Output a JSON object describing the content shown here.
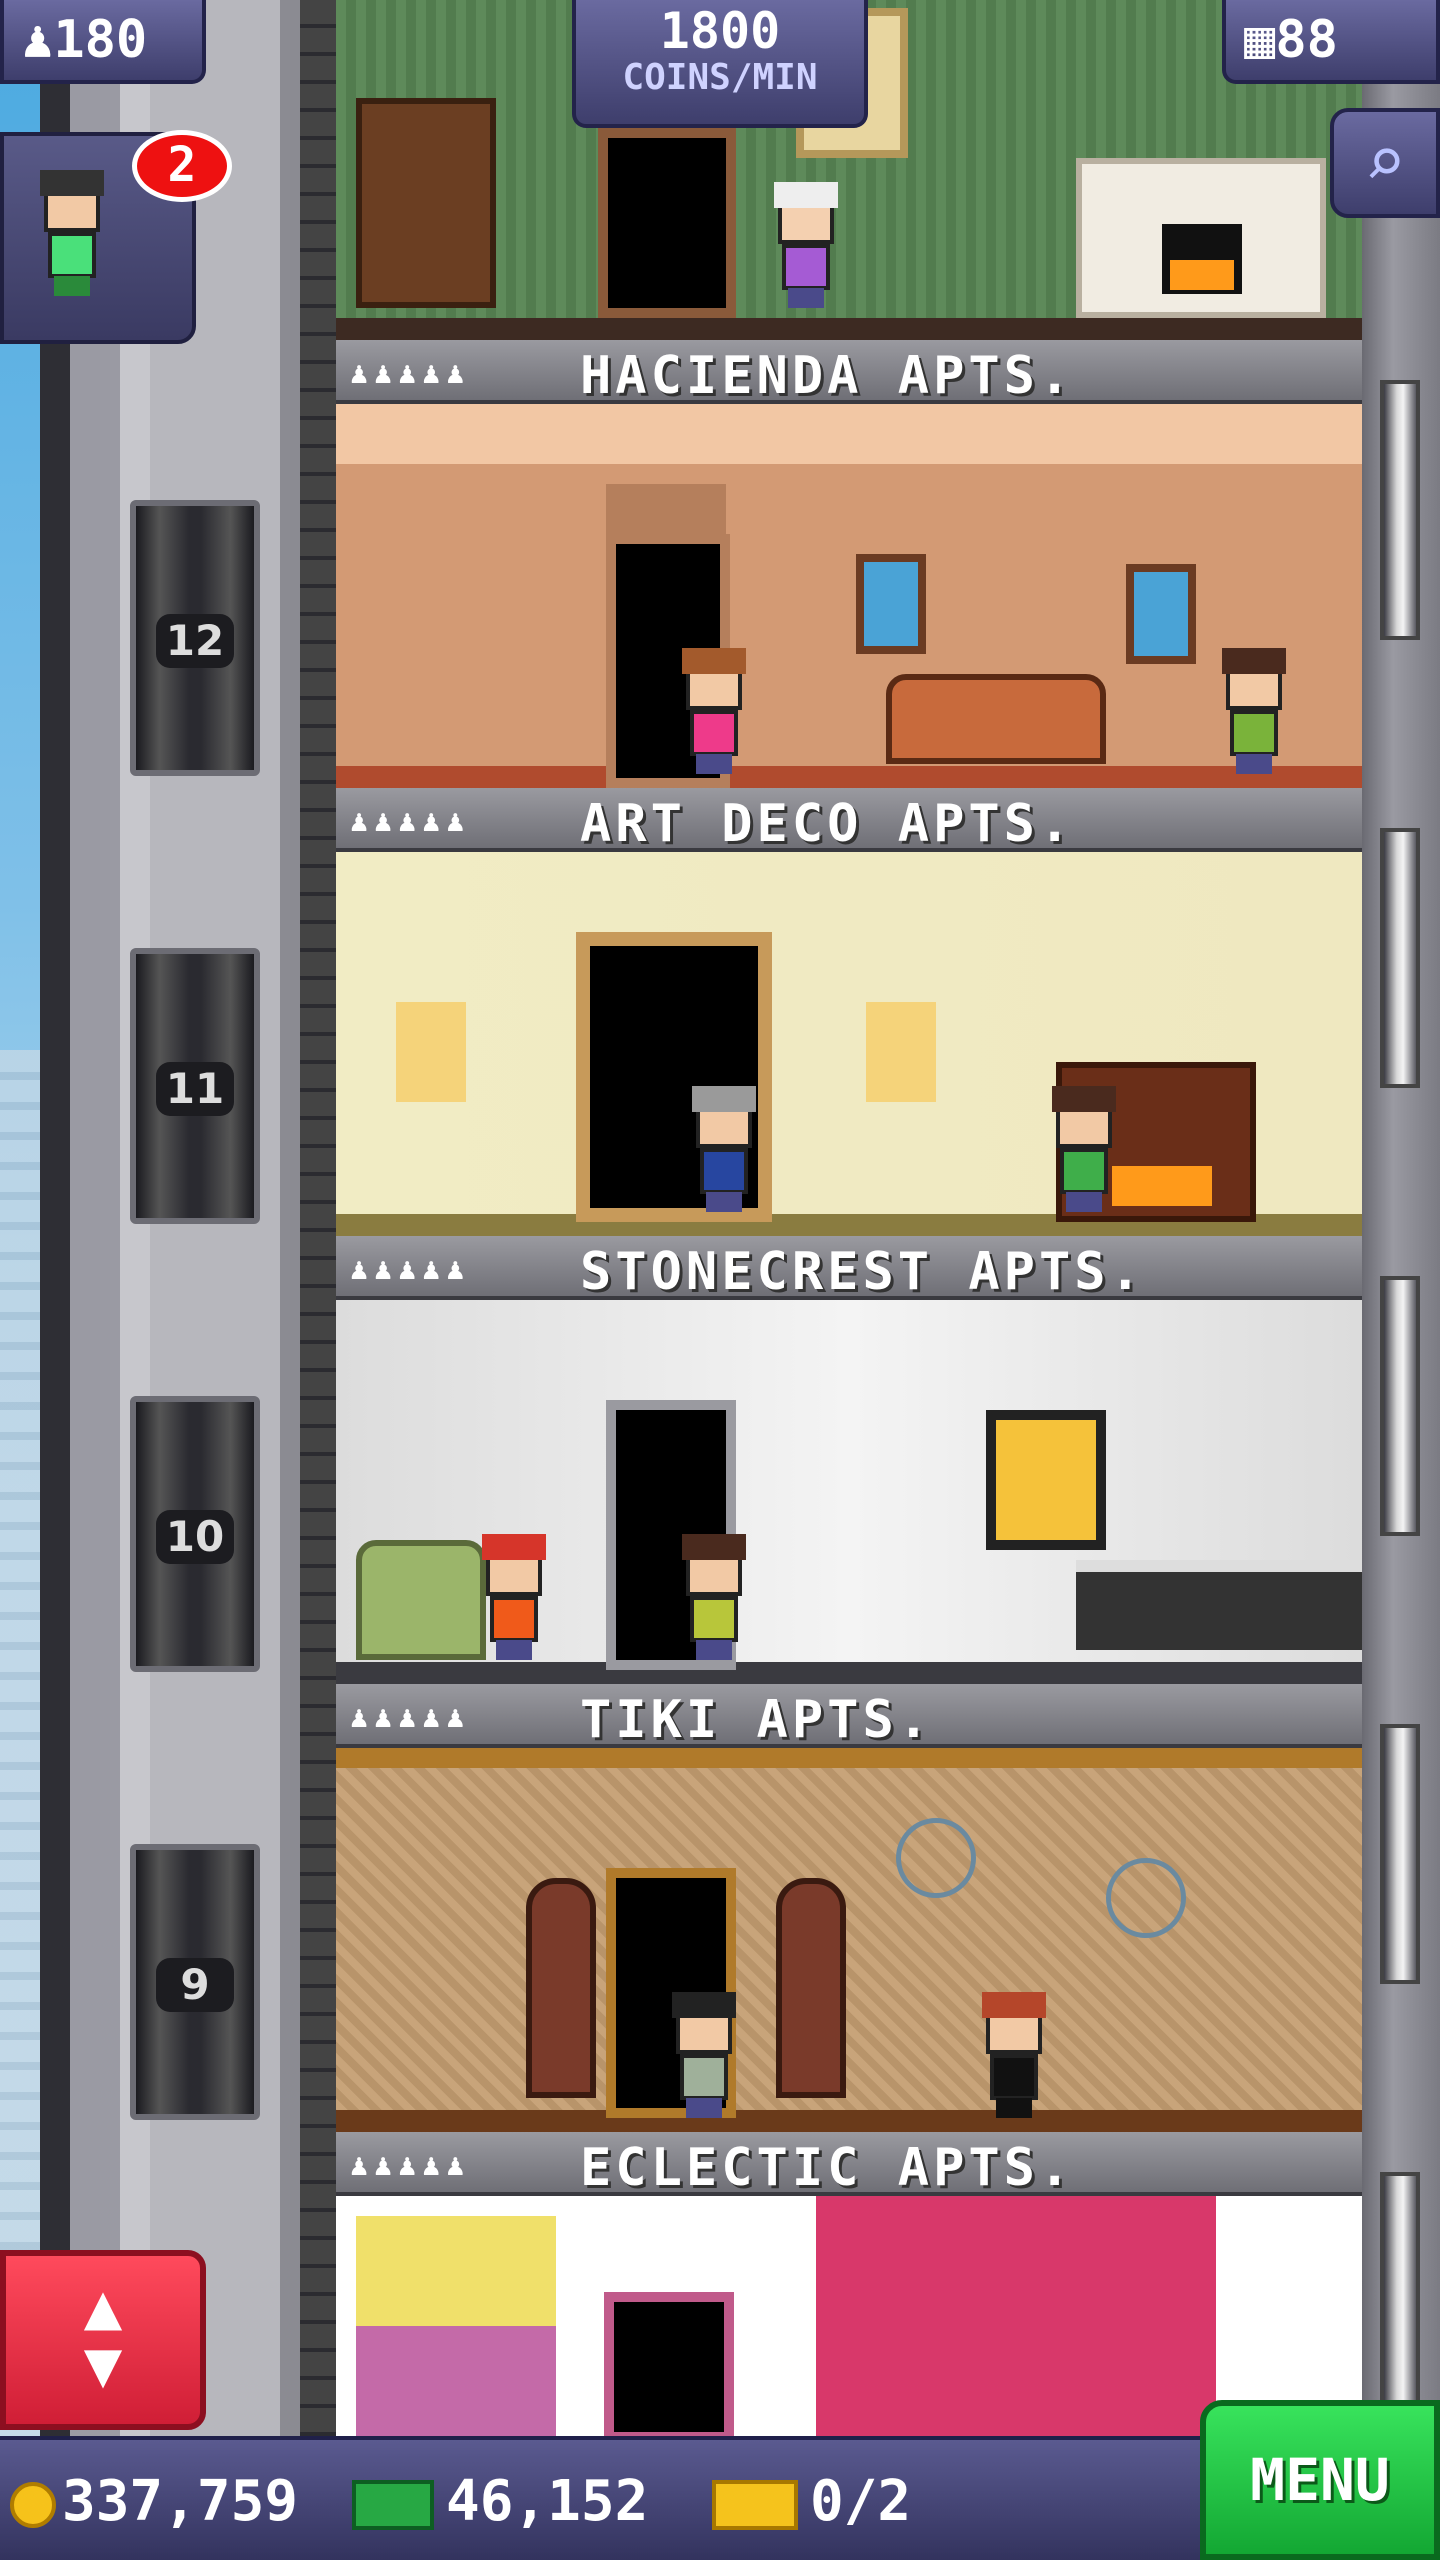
{
  "hud": {
    "population": "180",
    "coins_per_min_value": "1800",
    "coins_per_min_label": "COINS/MIN",
    "floors": "88",
    "notification_count": "2"
  },
  "elevator": {
    "floor_labels": [
      "12",
      "11",
      "10",
      "9"
    ]
  },
  "floors": [
    {
      "name": "HACIENDA APTS.",
      "occupancy": "♟♟♟♟♟"
    },
    {
      "name": "ART DECO APTS.",
      "occupancy": "♟♟♟♟♟"
    },
    {
      "name": "STONECREST APTS.",
      "occupancy": "♟♟♟♟♟"
    },
    {
      "name": "TIKI APTS.",
      "occupancy": "♟♟♟♟♟"
    },
    {
      "name": "ECLECTIC APTS.",
      "occupancy": "♟♟♟♟♟"
    }
  ],
  "bottom_bar": {
    "coins": "337,759",
    "bux": "46,152",
    "tickets": "0/2",
    "menu_label": "MENU"
  },
  "icons": {
    "population": "person-icon",
    "floors": "building-icon",
    "search": "magnifier-icon",
    "elevator": "up-down-arrows-icon",
    "coins": "coin-icon",
    "bux": "bux-icon",
    "tickets": "ticket-icon"
  },
  "colors": {
    "hud": "#3e3e6c",
    "menu": "#13a733",
    "elevator_button": "#d01e36",
    "badge": "#e11111"
  }
}
